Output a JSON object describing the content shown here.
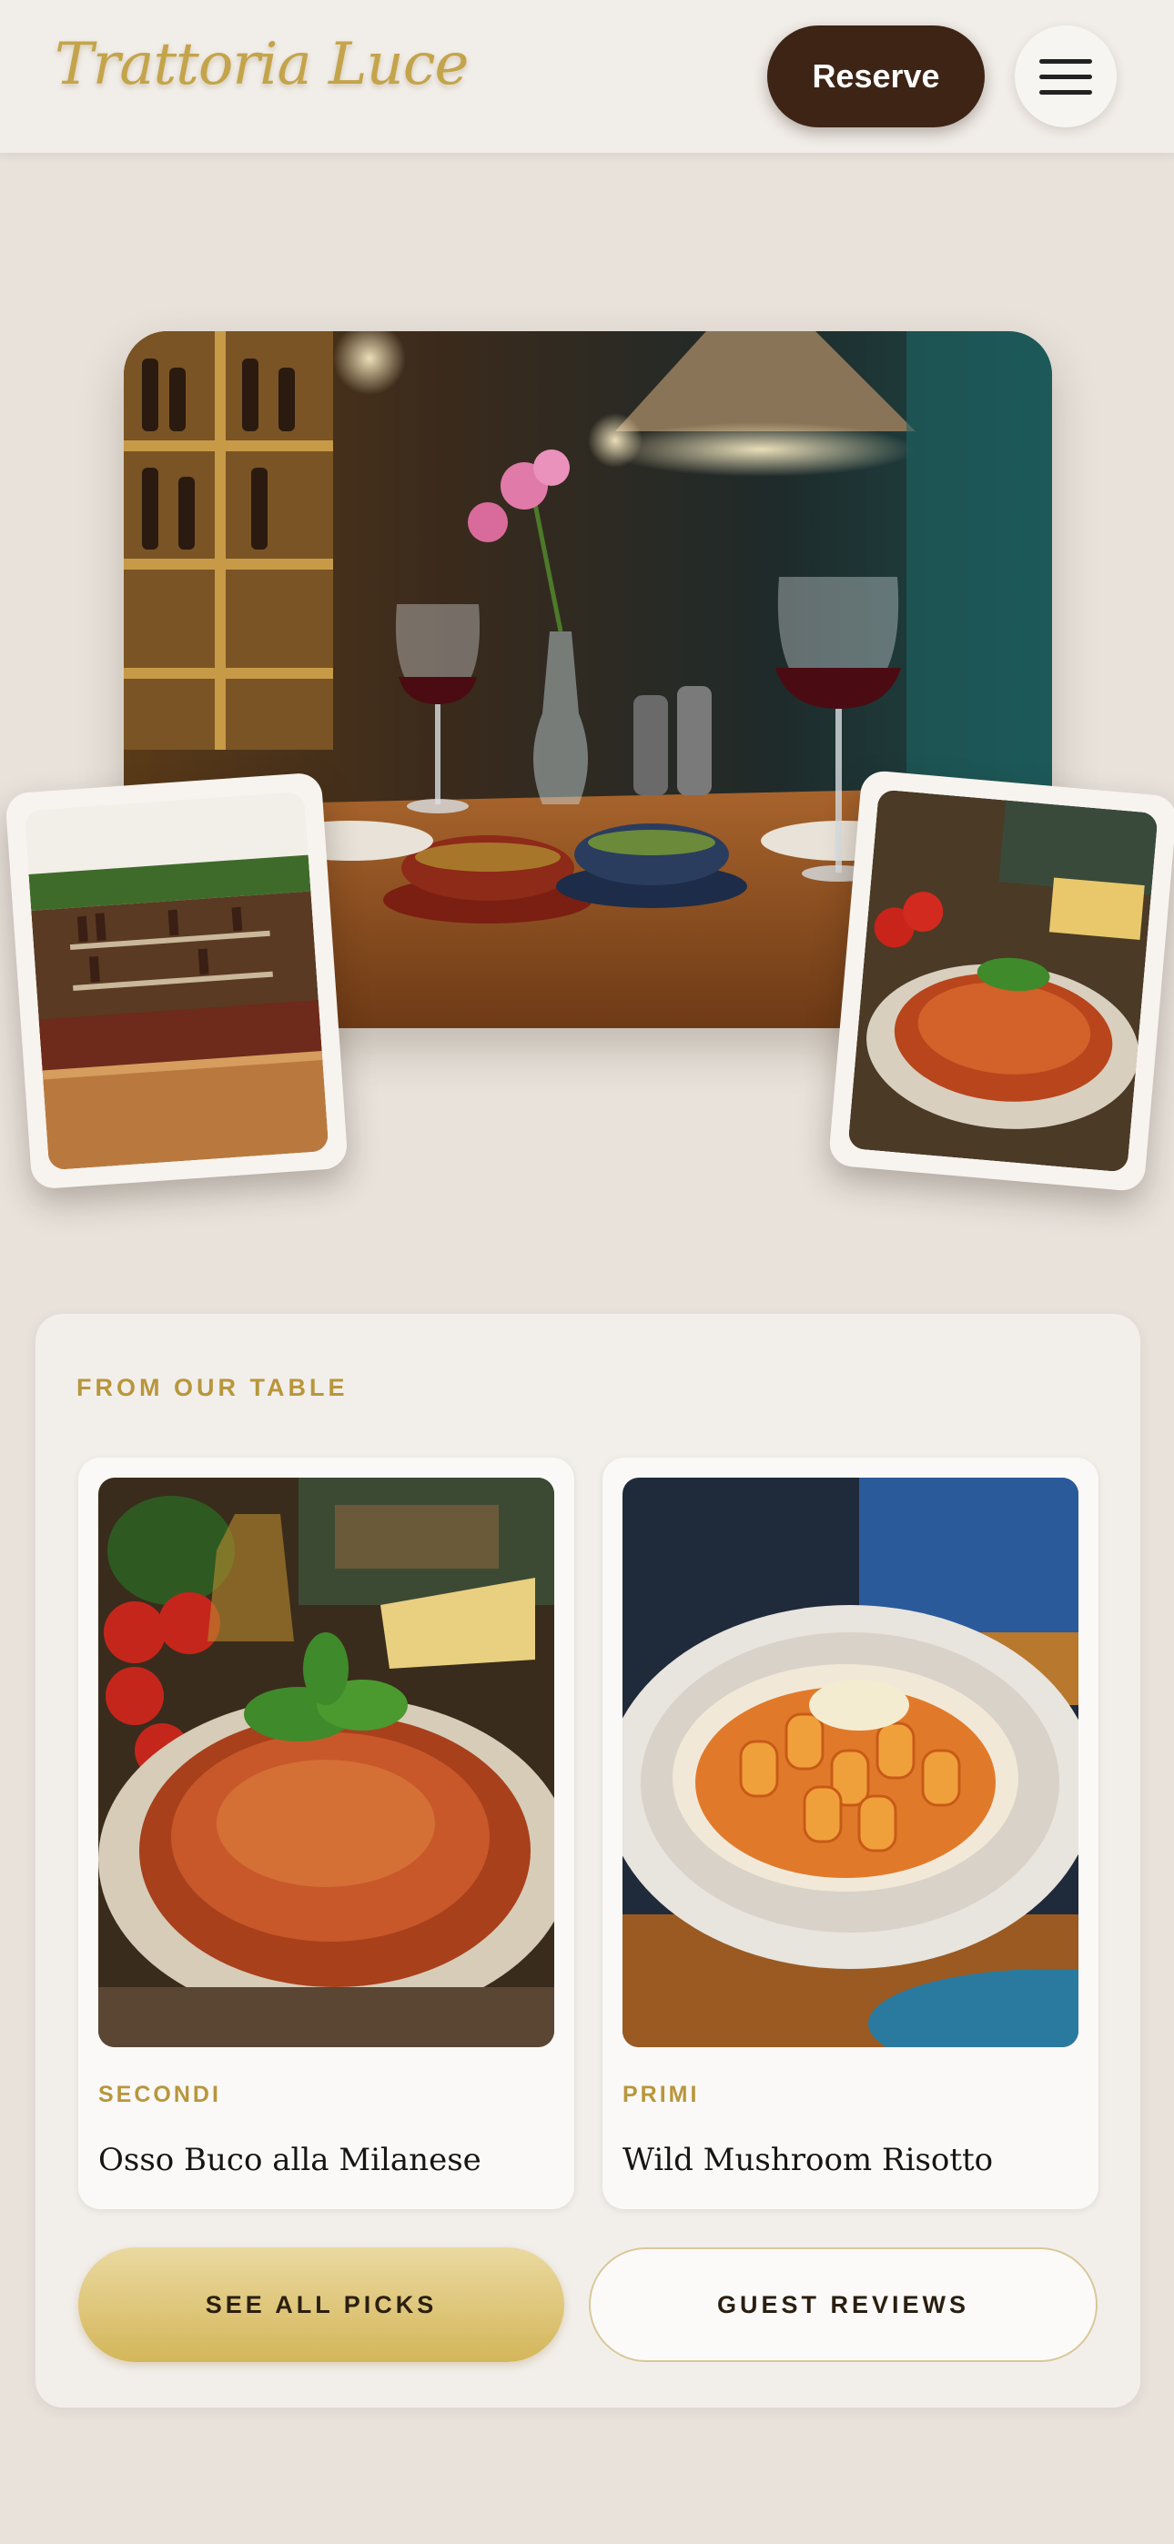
{
  "header": {
    "brand": "Trattoria Luce",
    "reserve_label": "Reserve",
    "menu_icon": "hamburger-menu-icon"
  },
  "hero": {
    "main_image": "restaurant-table-wine-photo",
    "left_polaroid": "bar-interior-photo",
    "right_polaroid": "spaghetti-bolognese-photo"
  },
  "picks": {
    "label": "FROM OUR TABLE",
    "cards": [
      {
        "category": "SECONDI",
        "dish": "Osso Buco alla Milanese",
        "image": "spaghetti-photo"
      },
      {
        "category": "PRIMI",
        "dish": "Wild Mushroom Risotto",
        "image": "rigatoni-photo"
      }
    ],
    "see_all_label": "SEE ALL PICKS",
    "reviews_label": "GUEST REVIEWS"
  },
  "colors": {
    "background": "#e8e2db",
    "accent_gold": "#c4a44a",
    "dark_brown": "#3d2415"
  }
}
